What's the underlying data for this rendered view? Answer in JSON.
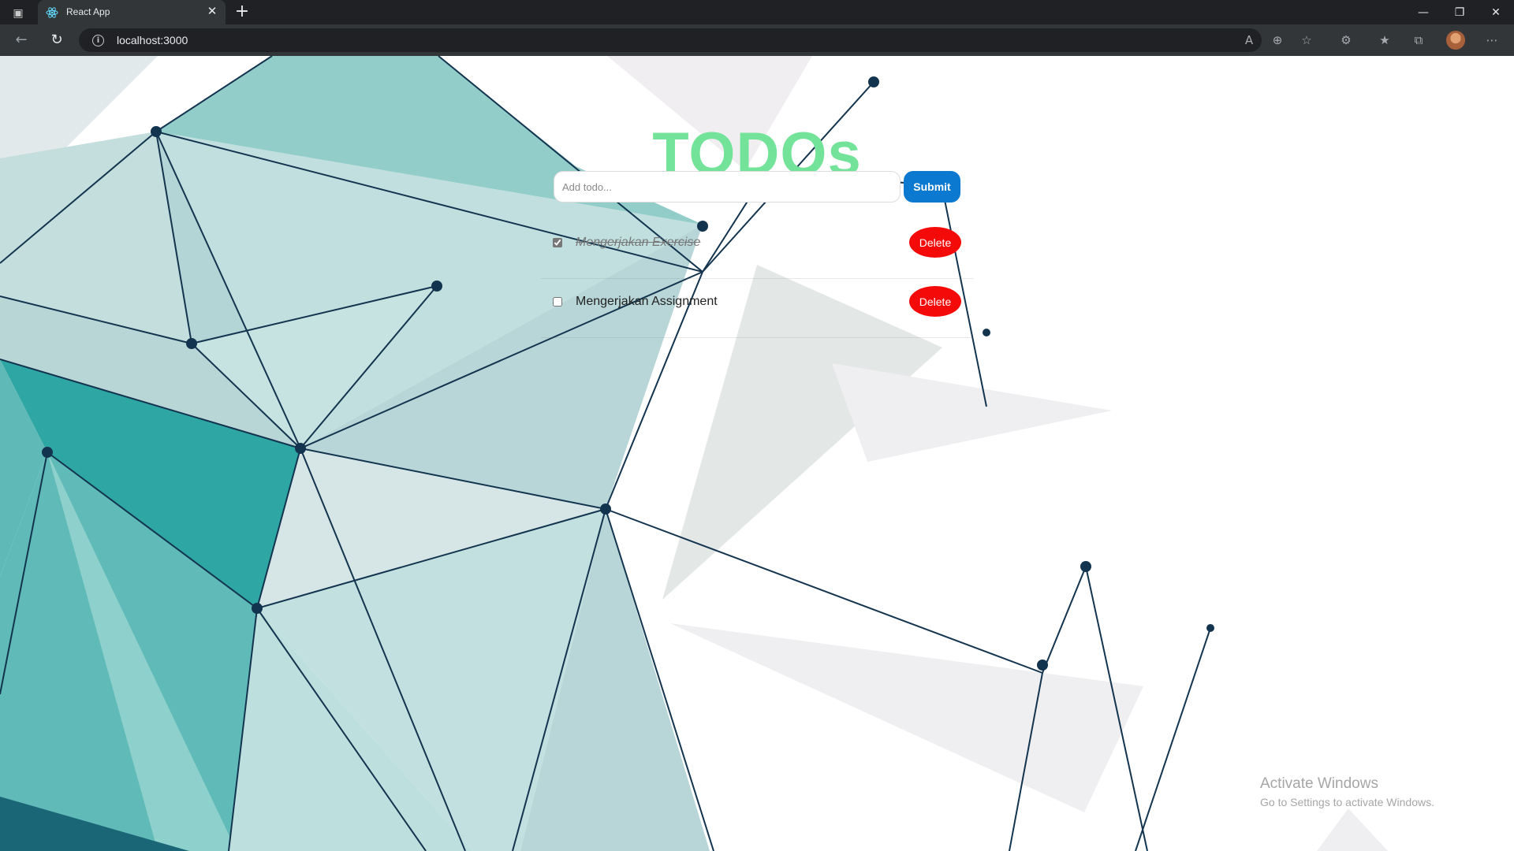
{
  "browser": {
    "tab_title": "React App",
    "url": "localhost:3000"
  },
  "app": {
    "title": "TODOs",
    "input_placeholder": "Add todo...",
    "submit_label": "Submit",
    "todos": [
      {
        "text": "Mengerjakan Exercise",
        "completed": true,
        "delete_label": "Delete"
      },
      {
        "text": "Mengerjakan Assignment",
        "completed": false,
        "delete_label": "Delete"
      }
    ]
  },
  "watermark": {
    "title": "Activate Windows",
    "subtitle": "Go to Settings to activate Windows."
  },
  "colors": {
    "title": "#74e39a",
    "submit": "#0b79d0",
    "delete": "#f50a0a",
    "teal_dark": "#2e9f9c",
    "teal_light": "#95ccc9",
    "node": "#13344f"
  }
}
